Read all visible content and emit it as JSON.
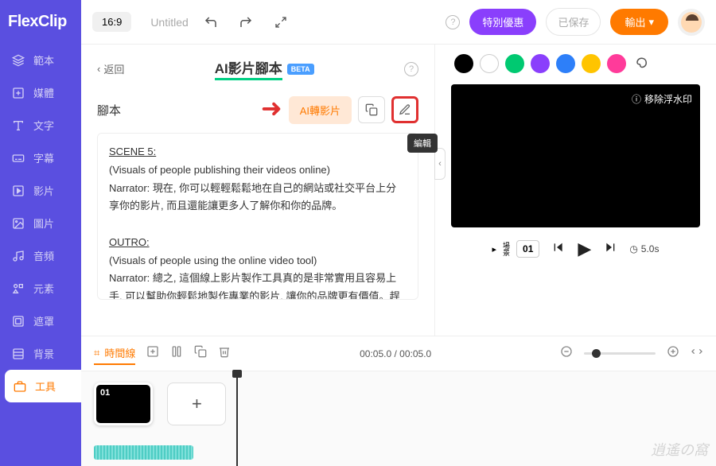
{
  "brand": "FlexClip",
  "sidebar": {
    "items": [
      {
        "label": "範本"
      },
      {
        "label": "媒體"
      },
      {
        "label": "文字"
      },
      {
        "label": "字幕"
      },
      {
        "label": "影片"
      },
      {
        "label": "圖片"
      },
      {
        "label": "音頻"
      },
      {
        "label": "元素"
      },
      {
        "label": "遮罩"
      },
      {
        "label": "背景"
      },
      {
        "label": "工具"
      }
    ]
  },
  "topbar": {
    "ratio": "16:9",
    "title": "Untitled",
    "special_offer": "特別優惠",
    "saved": "已保存",
    "export": "輸出"
  },
  "panel": {
    "back": "返回",
    "title_prefix": "AI",
    "title_rest": "影片腳本",
    "beta": "BETA",
    "script_label": "腳本",
    "ai_convert": "AI轉影片",
    "edit_tooltip": "編輯"
  },
  "script": {
    "scene5_title": "SCENE 5:",
    "scene5_visual": "(Visuals of people publishing their videos online)",
    "scene5_narr": "Narrator: 現在, 你可以輕輕鬆鬆地在自己的網站或社交平台上分享你的影片, 而且還能讓更多人了解你和你的品牌。",
    "outro_title": "OUTRO:",
    "outro_visual": "(Visuals of people using the online video tool)",
    "outro_narr": "Narrator: 總之, 這個線上影片製作工具真的是非常實用且容易上手, 可以幫助你輕鬆地製作專業的影片, 讓你的品牌更有價值。趕快來試試看吧!"
  },
  "colors": [
    "#000000",
    "#ffffff",
    "#00c971",
    "#8a3ffc",
    "#2d7ff9",
    "#ffc400",
    "#ff3b9a"
  ],
  "preview": {
    "watermark": "移除浮水印",
    "scene_label": "場景",
    "scene_num": "01",
    "duration": "5.0s"
  },
  "timeline": {
    "tab": "時間線",
    "time_display": "00:05.0 / 00:05.0",
    "clip_num": "01"
  }
}
